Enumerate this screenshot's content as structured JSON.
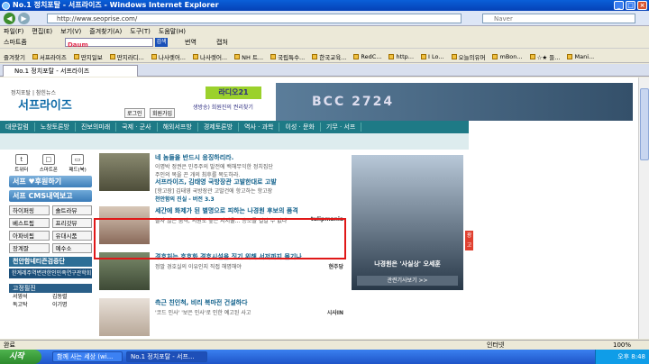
{
  "window": {
    "title": "No.1 정치포탈 - 서프라이즈 - Windows Internet Explorer",
    "address": "http://www.seoprise.com/",
    "search_placeholder": "Naver"
  },
  "menu": [
    "파일(F)",
    "편집(E)",
    "보기(V)",
    "즐겨찾기(A)",
    "도구(T)",
    "도움말(H)"
  ],
  "toolbar": {
    "label": "스마트줌",
    "search_brand": "Daum",
    "go": "검색",
    "translate": "번역",
    "zoom": "캡처"
  },
  "favorites": {
    "label": "즐겨찾기",
    "items": [
      "서프라이즈",
      "딴지일보",
      "딴지라디...",
      "나사렛어...",
      "나사렛어...",
      "NH 트...",
      "국립특수...",
      "한국교육...",
      "RedC...",
      "http...",
      "I Lo...",
      "오늘의유머",
      "mBon...",
      "☆★ 들...",
      "Mani..."
    ]
  },
  "tab": {
    "label": "No.1 정치포탈 - 서프라이즈"
  },
  "site": {
    "tagline": "정치포탈 | 참힌뉴스",
    "logo": "서프라이즈",
    "login": "로그인",
    "join": "회원가입",
    "radio": "라디오21",
    "radio_sub": "생방송) 희원진의 권리찾기",
    "banner": "BCC 2724",
    "nav": [
      "대문칼럼",
      "노창토론방",
      "진보의미래",
      "국제 · 군사",
      "해외서프방",
      "경제토론방",
      "역사 · 과학",
      "이성 · 문화",
      "기무 · 서프"
    ]
  },
  "sidebar": {
    "sns": [
      {
        "icon": "t",
        "label": "트위터"
      },
      {
        "icon": "□",
        "label": "스마트폰"
      },
      {
        "icon": "▭",
        "label": "패드(북)"
      }
    ],
    "support": "서프 ♥후원하기",
    "cms": "서프 CMS내역보고",
    "grid": [
      "하이퍼링",
      "솔트라뷰",
      "베스트됨",
      "프리갓뷰",
      "아파비됨",
      "유대시품",
      "장계잘",
      "예수소"
    ],
    "red_banner": "천안함네티즌검증단",
    "dark_banner": "한계레주역변관한인민족연구관학회",
    "fixed_head": "고정필진",
    "writers": [
      "서영석",
      "김동렬",
      "독고탁",
      "이기명"
    ]
  },
  "news": [
    {
      "title": "네 놈들을 반드시 응징하리라.",
      "lines": [
        "이명박 정권은 민주주의 발전에 백해무익한 정치집단",
        "주인의 목을 끈 개의 최후를 목도하라."
      ],
      "src": ""
    },
    {
      "title": "서프라이즈, 김태영 국방장관 고발한대로 고발",
      "lines": [
        "[항고장] 김태영 국방장관 고발건에 항고하는 항고장",
        "천안함의 진실 - 버전 3.3"
      ],
      "src": ""
    },
    {
      "title": "세간에 화제가 된 별명으로 피하는 나경원 후보의 품격",
      "lines": [
        "늘자 않은 품격, 의원로 높은 지지율... 승소를 걸칼 수 없다"
      ],
      "src": "tulipmania"
    },
    {
      "title": "경호처는 호호화 경호시설을 짓기 위해 서저까지 몰기나",
      "lines": [
        "정말 경호실의 이유인지 직접 해명해야"
      ],
      "src": "현주당"
    },
    {
      "title": "측근 친인척, 비리 복마전 건설하다",
      "lines": [
        "'코드 인사' '보은 인사'로 인한 예고된 사고"
      ],
      "src": "시사IN"
    }
  ],
  "ad": {
    "caption": "나경원은 '사실상' 오세훈",
    "button": "관련기사보기 >>",
    "side": "광고"
  },
  "statusbar": {
    "left": "완료",
    "zone": "인터넷",
    "zoom": "100%"
  },
  "taskbar": {
    "start": "시작",
    "items": [
      "함께 사는 세상 (wi...",
      "No.1 정치포탈 - 서프..."
    ],
    "clock": "오후 8:48"
  }
}
